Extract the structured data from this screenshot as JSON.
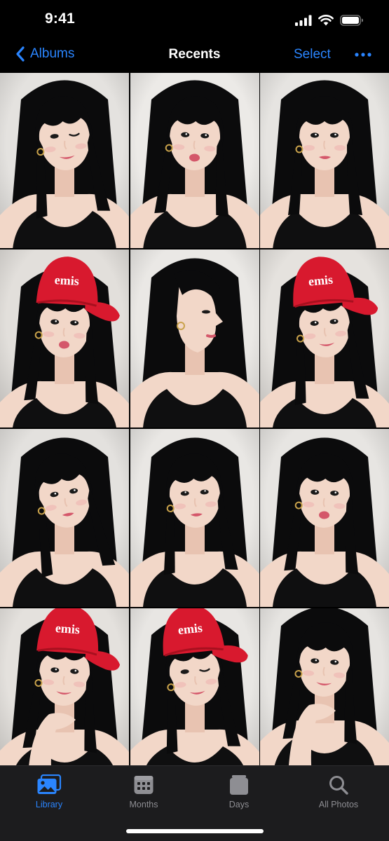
{
  "status_bar": {
    "time": "9:41"
  },
  "nav": {
    "back_label": "Albums",
    "title": "Recents",
    "select_label": "Select"
  },
  "photos": [
    {
      "id": 1,
      "pose": "wink",
      "cap": false,
      "bg": "#e4e2df"
    },
    {
      "id": 2,
      "pose": "pout",
      "cap": false,
      "bg": "#eceae7"
    },
    {
      "id": 3,
      "pose": "neutral",
      "cap": false,
      "bg": "#e6e4e1"
    },
    {
      "id": 4,
      "pose": "pout",
      "cap": true,
      "cap_text": "emis",
      "bg": "#e2dfdb"
    },
    {
      "id": 5,
      "pose": "profile",
      "cap": false,
      "bg": "#eae8e5"
    },
    {
      "id": 6,
      "pose": "smile",
      "cap": true,
      "cap_text": "emis",
      "bg": "#e5e2de"
    },
    {
      "id": 7,
      "pose": "tilt",
      "cap": false,
      "bg": "#e3e1de"
    },
    {
      "id": 8,
      "pose": "look-up",
      "cap": false,
      "bg": "#e9e7e4"
    },
    {
      "id": 9,
      "pose": "pout",
      "cap": false,
      "bg": "#e7e5e2"
    },
    {
      "id": 10,
      "pose": "hand-chin",
      "cap": true,
      "cap_text": "emis",
      "bg": "#e4e1dd"
    },
    {
      "id": 11,
      "pose": "wink",
      "cap": true,
      "cap_text": "emis",
      "bg": "#e8e6e3"
    },
    {
      "id": 12,
      "pose": "hand-chin",
      "cap": false,
      "bg": "#e6e4e1"
    }
  ],
  "tabs": [
    {
      "label": "Library",
      "icon": "photo-library-icon",
      "active": true
    },
    {
      "label": "Months",
      "icon": "calendar-icon",
      "active": false
    },
    {
      "label": "Days",
      "icon": "stacked-cards-icon",
      "active": false
    },
    {
      "label": "All Photos",
      "icon": "search-icon",
      "active": false
    }
  ],
  "colors": {
    "accent": "#2a85ff",
    "background": "#000000",
    "tab_bar": "#1c1c1e",
    "inactive": "#8e8e93",
    "cap_red": "#d8192e"
  }
}
